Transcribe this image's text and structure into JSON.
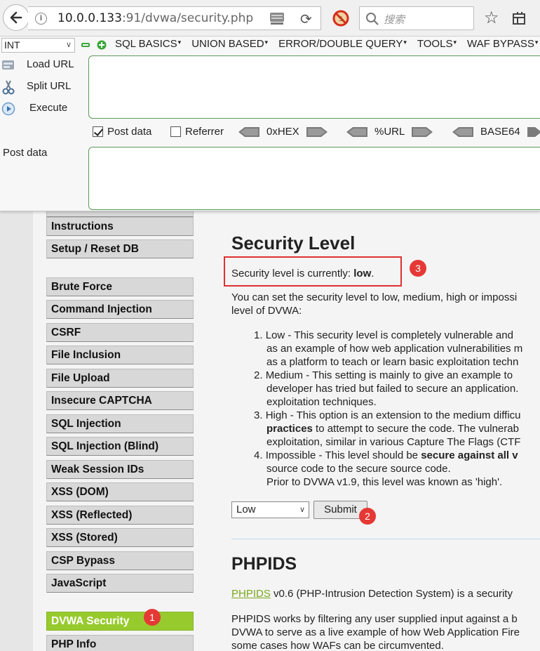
{
  "browser": {
    "url_host": "10.0.0.133",
    "url_rest": ":91/dvwa/security.php",
    "search_placeholder": "搜索"
  },
  "hackbar": {
    "select_value": "INT",
    "menus": [
      "SQL BASICS",
      "UNION BASED",
      "ERROR/DOUBLE QUERY",
      "TOOLS",
      "WAF BYPASS"
    ],
    "load_url": "Load URL",
    "split_url": "Split URL",
    "execute": "Execute",
    "post_data_check": "Post data",
    "referrer_check": "Referrer",
    "enc_hex": "0xHEX",
    "enc_url": "%URL",
    "enc_base64": "BASE64",
    "post_data_label": "Post data"
  },
  "nav": {
    "items": [
      "Instructions",
      "Setup / Reset DB",
      "Brute Force",
      "Command Injection",
      "CSRF",
      "File Inclusion",
      "File Upload",
      "Insecure CAPTCHA",
      "SQL Injection",
      "SQL Injection (Blind)",
      "Weak Session IDs",
      "XSS (DOM)",
      "XSS (Reflected)",
      "XSS (Stored)",
      "CSP Bypass",
      "JavaScript",
      "DVWA Security",
      "PHP Info"
    ]
  },
  "main": {
    "heading": "Security Level",
    "status_prefix": "Security level is currently: ",
    "status_value": "low",
    "status_suffix": ".",
    "intro_line1": "You can set the security level to low, medium, high or impossi",
    "intro_line2": "level of DVWA:",
    "levels": {
      "l1a": "Low - This security level is completely vulnerable and",
      "l1b": "as an example of how web application vulnerabilities m",
      "l1c": "as a platform to teach or learn basic exploitation techn",
      "l2a": "Medium - This setting is mainly to give an example to",
      "l2b": "developer has tried but failed to secure an application.",
      "l2c": "exploitation techniques.",
      "l3a": "High - This option is an extension to the medium difficu",
      "l3b_bold": "practices",
      "l3b_rest": " to attempt to secure the code. The vulnerab",
      "l3c": "exploitation, similar in various Capture The Flags (CTF",
      "l4a_pre": "Impossible - This level should be ",
      "l4a_bold": "secure against all v",
      "l4b": "source code to the secure source code.",
      "l4c": "Prior to DVWA v1.9, this level was known as 'high'."
    },
    "select_value": "Low",
    "submit_label": "Submit",
    "phpids_heading": "PHPIDS",
    "phpids_link": "PHPIDS",
    "phpids_line1_rest": " v0.6 (PHP-Intrusion Detection System) is a security",
    "phpids_p2_l1": "PHPIDS works by filtering any user supplied input against a b",
    "phpids_p2_l2": "DVWA to serve as a live example of how Web Application Fire",
    "phpids_p2_l3": "some cases how WAFs can be circumvented."
  },
  "annotations": {
    "badge1": "1",
    "badge2": "2",
    "badge3": "3",
    "color": "#e53935"
  }
}
